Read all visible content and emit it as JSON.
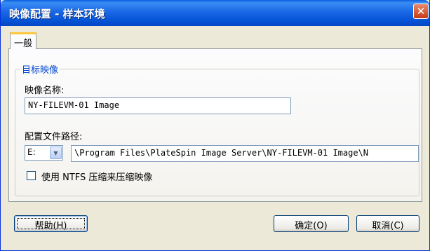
{
  "window": {
    "title": "映像配置 - 样本环境",
    "close_glyph": "✕"
  },
  "tabs": [
    {
      "label": "一般",
      "selected": true
    }
  ],
  "group": {
    "label": "目标映像",
    "image_name_label": "映像名称:",
    "image_name_value": "NY-FILEVM-01 Image",
    "config_path_label": "配置文件路径:",
    "drive_value": "E:",
    "config_path_value": "\\Program Files\\PlateSpin Image Server\\NY-FILEVM-01 Image\\N",
    "compress_label": "使用 NTFS 压缩来压缩映像",
    "compress_checked": false
  },
  "buttons": {
    "help": "帮助(H)",
    "ok": "确定(O)",
    "cancel": "取消(C)"
  },
  "icons": {
    "close": "close-icon",
    "dropdown": "chevron-down-icon"
  },
  "colors": {
    "titlebar": "#0554d6",
    "group_label": "#0046d5",
    "tab_highlight": "#ffc83c",
    "close_button": "#c43b16"
  }
}
